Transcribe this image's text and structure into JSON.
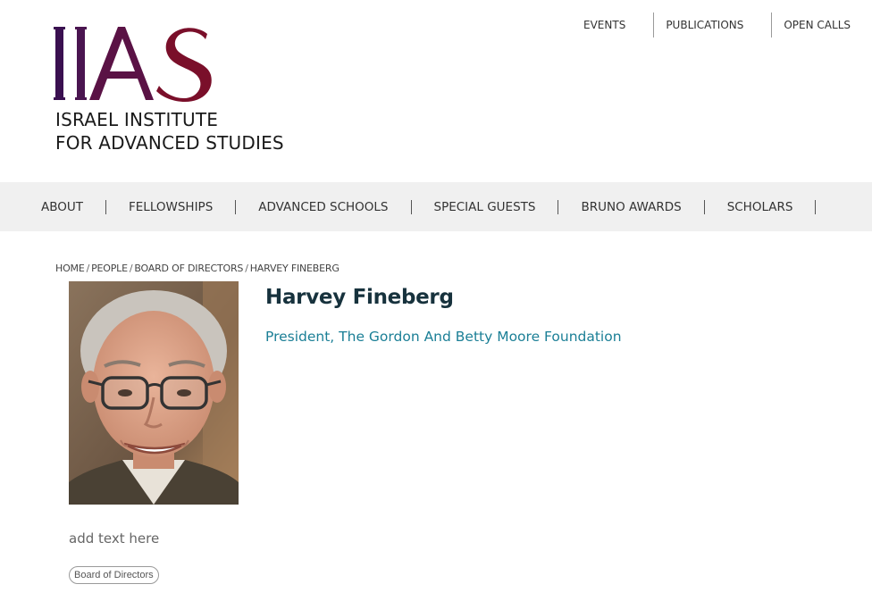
{
  "brand": {
    "logo_monogram": "IIAS",
    "name_line1": "ISRAEL INSTITUTE",
    "name_line2": "FOR ADVANCED STUDIES",
    "colors": {
      "monogram_primary": "#3a1050",
      "monogram_secondary": "#7a0f2a"
    }
  },
  "top_nav": {
    "items": [
      {
        "label": "EVENTS"
      },
      {
        "label": "PUBLICATIONS"
      },
      {
        "label": "OPEN CALLS"
      }
    ]
  },
  "main_nav": {
    "items": [
      {
        "label": "ABOUT"
      },
      {
        "label": "FELLOWSHIPS"
      },
      {
        "label": "ADVANCED SCHOOLS"
      },
      {
        "label": "SPECIAL GUESTS"
      },
      {
        "label": "BRUNO AWARDS"
      },
      {
        "label": "SCHOLARS"
      }
    ]
  },
  "breadcrumb": {
    "items": [
      {
        "label": "HOME"
      },
      {
        "label": "PEOPLE"
      },
      {
        "label": "BOARD OF DIRECTORS"
      },
      {
        "label": "HARVEY FINEBERG"
      }
    ],
    "separator": "/"
  },
  "profile": {
    "name": "Harvey Fineberg",
    "title": "President, The Gordon And Betty Moore Foundation",
    "bio": "add text here",
    "tag": "Board of Directors",
    "colors": {
      "name": "#17323d",
      "title": "#1b7f96"
    }
  }
}
